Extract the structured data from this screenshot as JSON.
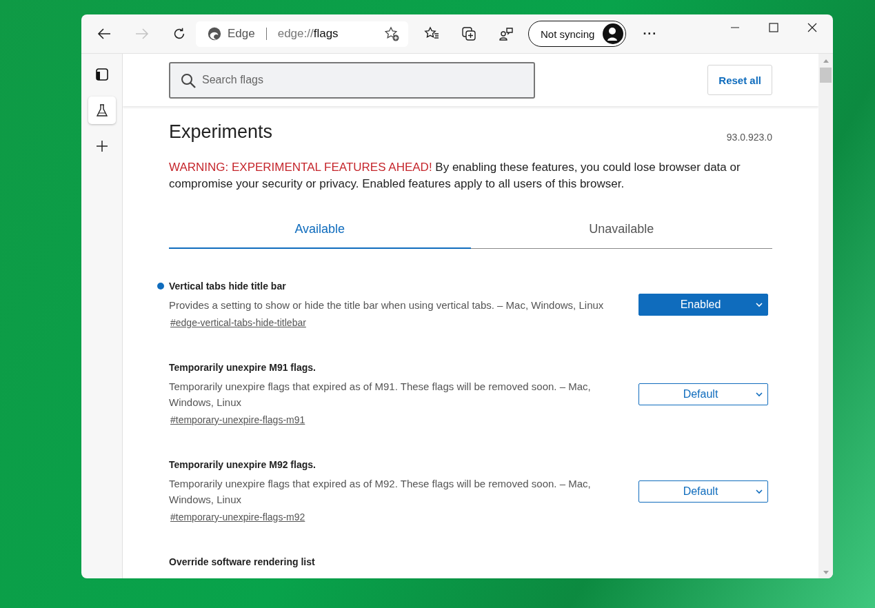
{
  "toolbar": {
    "site_name": "Edge",
    "url_prefix": "edge://",
    "url_path": "flags",
    "profile_label": "Not syncing",
    "more_label": "···"
  },
  "sidebar": {
    "items": [
      {
        "kind": "tabs",
        "selected": false
      },
      {
        "kind": "flask",
        "selected": true
      },
      {
        "kind": "add",
        "selected": false
      }
    ]
  },
  "search": {
    "placeholder": "Search flags"
  },
  "reset_button": "Reset all",
  "page": {
    "title": "Experiments",
    "version": "93.0.923.0",
    "warning_label": "WARNING: EXPERIMENTAL FEATURES AHEAD!",
    "warning_text": "By enabling these features, you could lose browser data or compromise your security or privacy. Enabled features apply to all users of this browser."
  },
  "tabs": [
    {
      "label": "Available",
      "selected": true
    },
    {
      "label": "Unavailable",
      "selected": false
    }
  ],
  "flags": [
    {
      "title": "Vertical tabs hide title bar",
      "description": "Provides a setting to show or hide the title bar when using vertical tabs. – Mac, Windows, Linux",
      "link": "#edge-vertical-tabs-hide-titlebar",
      "value": "Enabled",
      "modified": true
    },
    {
      "title": "Temporarily unexpire M91 flags.",
      "description": "Temporarily unexpire flags that expired as of M91. These flags will be removed soon. – Mac, Windows, Linux",
      "link": "#temporary-unexpire-flags-m91",
      "value": "Default",
      "modified": false
    },
    {
      "title": "Temporarily unexpire M92 flags.",
      "description": "Temporarily unexpire flags that expired as of M92. These flags will be removed soon. – Mac, Windows, Linux",
      "link": "#temporary-unexpire-flags-m92",
      "value": "Default",
      "modified": false
    },
    {
      "title": "Override software rendering list"
    }
  ]
}
